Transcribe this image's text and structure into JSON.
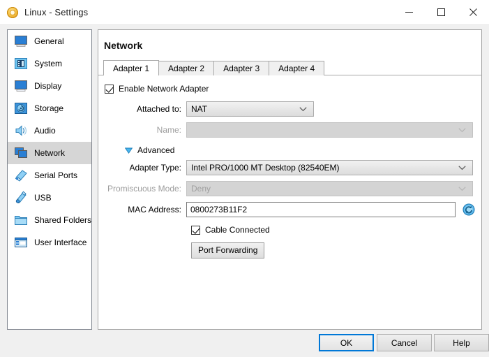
{
  "window": {
    "title": "Linux - Settings",
    "icon": "virtualbox-gear-icon",
    "controls": {
      "minimize": "minimize-icon",
      "maximize": "maximize-icon",
      "close": "close-icon"
    }
  },
  "sidebar": {
    "items": [
      {
        "label": "General",
        "icon": "monitor-icon",
        "selected": false
      },
      {
        "label": "System",
        "icon": "motherboard-icon",
        "selected": false
      },
      {
        "label": "Display",
        "icon": "display-icon",
        "selected": false
      },
      {
        "label": "Storage",
        "icon": "harddisk-icon",
        "selected": false
      },
      {
        "label": "Audio",
        "icon": "speaker-icon",
        "selected": false
      },
      {
        "label": "Network",
        "icon": "network-cards-icon",
        "selected": true
      },
      {
        "label": "Serial Ports",
        "icon": "serial-port-icon",
        "selected": false
      },
      {
        "label": "USB",
        "icon": "usb-icon",
        "selected": false
      },
      {
        "label": "Shared Folders",
        "icon": "folder-icon",
        "selected": false
      },
      {
        "label": "User Interface",
        "icon": "window-icon",
        "selected": false
      }
    ]
  },
  "content": {
    "page_title": "Network",
    "tabs": [
      {
        "label": "Adapter 1",
        "active": true
      },
      {
        "label": "Adapter 2",
        "active": false
      },
      {
        "label": "Adapter 3",
        "active": false
      },
      {
        "label": "Adapter 4",
        "active": false
      }
    ],
    "enable_adapter": {
      "label": "Enable Network Adapter",
      "checked": true
    },
    "attached_to": {
      "label": "Attached to:",
      "value": "NAT",
      "enabled": true
    },
    "name_field": {
      "label": "Name:",
      "value": "",
      "enabled": false
    },
    "advanced": {
      "label": "Advanced",
      "expanded": true,
      "icon": "triangle-down-icon"
    },
    "adapter_type": {
      "label": "Adapter Type:",
      "value": "Intel PRO/1000 MT Desktop (82540EM)",
      "enabled": true
    },
    "promiscuous_mode": {
      "label": "Promiscuous Mode:",
      "value": "Deny",
      "enabled": false
    },
    "mac_address": {
      "label": "MAC Address:",
      "value": "0800273B11F2",
      "placeholder": ""
    },
    "mac_refresh": {
      "icon": "refresh-circular-icon",
      "tooltip": ""
    },
    "cable_connected": {
      "label": "Cable Connected",
      "checked": true
    },
    "port_forwarding": {
      "label": "Port Forwarding"
    }
  },
  "footer": {
    "ok": "OK",
    "cancel": "Cancel",
    "help": "Help"
  },
  "colors": {
    "accent": "#0078d7",
    "selection": "#d6d6d6",
    "window_bg": "#f0f0f0",
    "panel_bg": "#ffffff",
    "icon_blue": "#2a7fd4"
  }
}
